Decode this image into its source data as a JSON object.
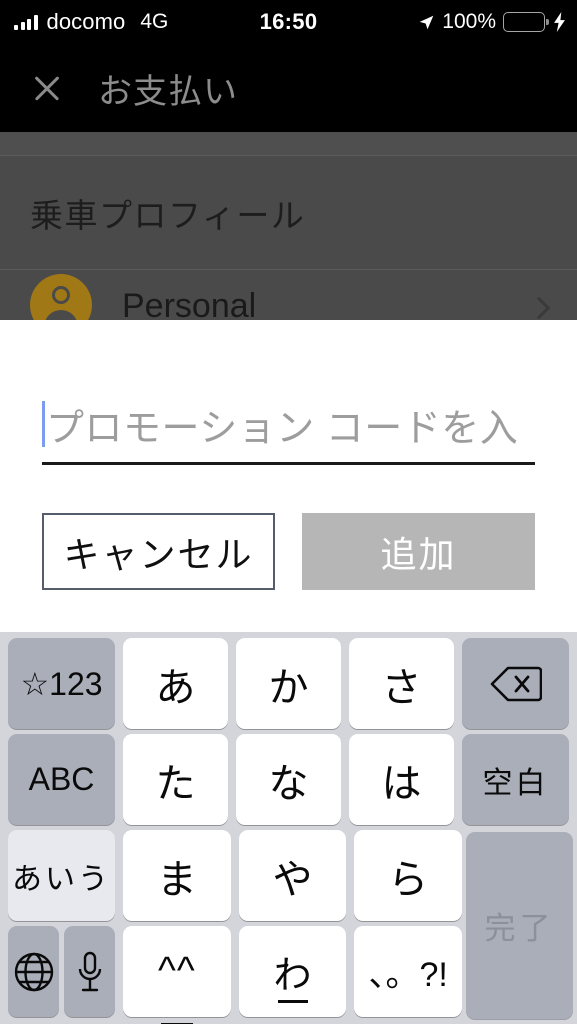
{
  "statusbar": {
    "carrier": "docomo",
    "network": "4G",
    "time": "16:50",
    "battery_percent": "100%",
    "signal_icon": "signal-bars-icon",
    "location_icon": "location-arrow-icon",
    "battery_icon": "battery-full-icon",
    "charging_icon": "lightning-bolt-icon",
    "battery_color": "#4cd964"
  },
  "appnav": {
    "close_icon": "close-x-icon",
    "title": "お支払い"
  },
  "background": {
    "section_header": "乗車プロフィール",
    "row": {
      "avatar_icon": "person-avatar-icon",
      "label": "Personal",
      "chevron_icon": "chevron-right-icon"
    }
  },
  "dialog": {
    "input": {
      "placeholder": "プロモーション コードを入",
      "value": ""
    },
    "cancel_label": "キャンセル",
    "add_label": "追加",
    "add_enabled": false,
    "add_bg_color": "#b6b6b6"
  },
  "keyboard": {
    "rows": [
      {
        "left": {
          "label": "☆123",
          "name": "key-symbols-123",
          "style": "gray"
        },
        "chars": [
          {
            "label": "あ",
            "name": "key-a"
          },
          {
            "label": "か",
            "name": "key-ka"
          },
          {
            "label": "さ",
            "name": "key-sa"
          }
        ],
        "right": {
          "label": "",
          "name": "key-backspace",
          "icon": "backspace-icon",
          "style": "gray"
        }
      },
      {
        "left": {
          "label": "ABC",
          "name": "key-abc",
          "style": "gray"
        },
        "chars": [
          {
            "label": "た",
            "name": "key-ta"
          },
          {
            "label": "な",
            "name": "key-na"
          },
          {
            "label": "は",
            "name": "key-ha"
          }
        ],
        "right": {
          "label": "空白",
          "name": "key-space",
          "style": "gray"
        }
      },
      {
        "left": {
          "label": "あいう",
          "name": "key-aiu",
          "style": "light"
        },
        "chars": [
          {
            "label": "ま",
            "name": "key-ma"
          },
          {
            "label": "や",
            "name": "key-ya"
          },
          {
            "label": "ら",
            "name": "key-ra"
          }
        ]
      },
      {
        "left_half": [
          {
            "label": "",
            "name": "key-globe",
            "icon": "globe-icon"
          },
          {
            "label": "",
            "name": "key-microphone",
            "icon": "microphone-icon"
          }
        ],
        "chars": [
          {
            "label": "^^",
            "name": "key-emoticon"
          },
          {
            "label": "わ",
            "name": "key-wa"
          },
          {
            "label": "、。?!",
            "name": "key-punctuation"
          }
        ]
      }
    ],
    "done_key": {
      "label": "完了",
      "name": "key-done",
      "enabled": false
    }
  }
}
